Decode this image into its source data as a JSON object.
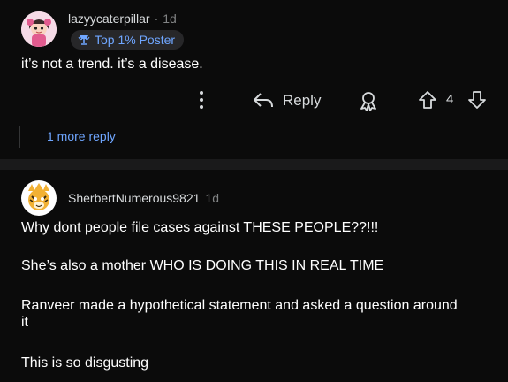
{
  "comment1": {
    "username": "lazyycaterpillar",
    "separator": "·",
    "time": "1d",
    "badge": "Top 1% Poster",
    "text": "it’s not a trend. it’s a disease.",
    "actions": {
      "reply_label": "Reply",
      "vote_count": "4"
    },
    "more_replies": "1 more reply"
  },
  "comment2": {
    "username": "SherbertNumerous9821",
    "time": "1d",
    "paragraphs": [
      "Why dont people file cases against THESE PEOPLE??!!!",
      "She’s also a mother WHO IS DOING THIS IN REAL TIME",
      "Ranveer made a hypothetical statement and asked a question around it",
      "This is so disgusting"
    ]
  },
  "colors": {
    "background": "#0b0b0b",
    "separator": "#1a1a1b",
    "link_blue": "#6fa6ff",
    "muted": "#818384"
  }
}
